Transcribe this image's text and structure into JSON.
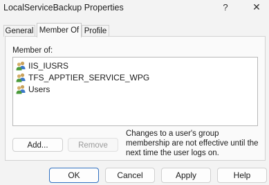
{
  "window": {
    "title": "LocalServiceBackup Properties",
    "help_glyph": "?",
    "close_glyph": "✕"
  },
  "tabs": [
    {
      "label": "General",
      "active": false
    },
    {
      "label": "Member Of",
      "active": true
    },
    {
      "label": "Profile",
      "active": false
    }
  ],
  "member_of": {
    "label": "Member of:",
    "items": [
      {
        "name": "IIS_IUSRS",
        "icon": "group-icon"
      },
      {
        "name": "TFS_APPTIER_SERVICE_WPG",
        "icon": "group-icon"
      },
      {
        "name": "Users",
        "icon": "group-icon"
      }
    ],
    "add_label": "Add...",
    "remove_label": "Remove",
    "note": "Changes to a user's group membership are not effective until the next time the user logs on."
  },
  "footer": {
    "ok": "OK",
    "cancel": "Cancel",
    "apply": "Apply",
    "help": "Help"
  }
}
